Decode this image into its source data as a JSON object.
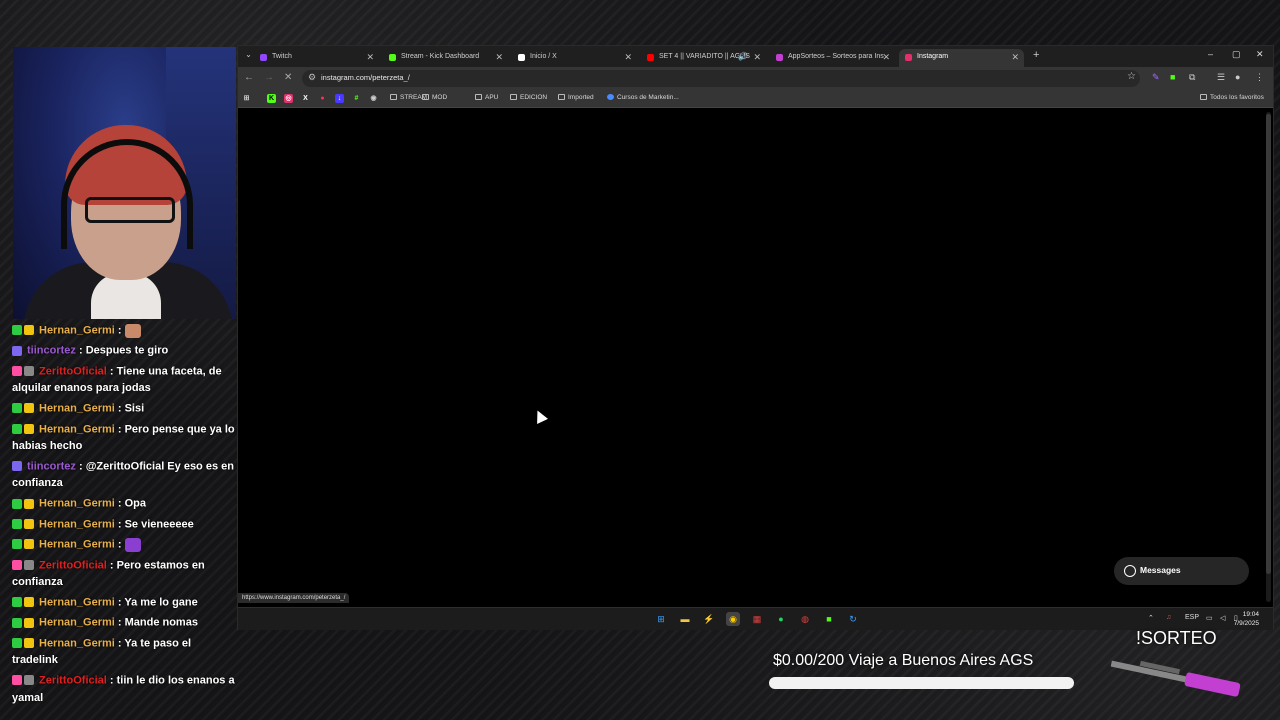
{
  "browser": {
    "tabs": [
      {
        "label": "Twitch",
        "favicon_color": "#9146ff"
      },
      {
        "label": "Stream - Kick Dashboard",
        "favicon_color": "#53fc18"
      },
      {
        "label": "Inicio / X",
        "favicon_color": "#ffffff"
      },
      {
        "label": "SET 4 || VARIADITO || AGUS",
        "favicon_color": "#ff0000"
      },
      {
        "label": "AppSorteos – Sorteos para Ins",
        "favicon_color": "#c23fd1"
      },
      {
        "label": "Instagram",
        "favicon_color": "#e1306c",
        "active": true
      }
    ],
    "address": "instagram.com/peterzeta_/",
    "bookmarks": [
      "STREAM",
      "MOD",
      "APU",
      "EDICION",
      "Imported",
      "Cursos de Marketin..."
    ],
    "all_bookmarks": "Todos los favoritos",
    "status_url": "https://www.instagram.com/peterzeta_/",
    "messages_button": "Messages"
  },
  "taskbar": {
    "language": "ESP",
    "time": "19:04",
    "date": "7/9/2025"
  },
  "chat": [
    {
      "user": "Hernan_Germi",
      "color": "#e8b04a",
      "badges": [
        "#2ecc40",
        "#f1c40f"
      ],
      "text": "",
      "emote": "#c98a6a"
    },
    {
      "user": "tiincortez",
      "color": "#9b59d0",
      "badges": [
        "#7b68ee"
      ],
      "text": "Despues te giro"
    },
    {
      "user": "ZerittoOficial",
      "color": "#e02020",
      "badges": [
        "#ff4fa3",
        "#888888"
      ],
      "text": "Tiene una faceta, de alquilar enanos para jodas"
    },
    {
      "user": "Hernan_Germi",
      "color": "#e8b04a",
      "badges": [
        "#2ecc40",
        "#f1c40f"
      ],
      "text": "Sisi"
    },
    {
      "user": "Hernan_Germi",
      "color": "#e8b04a",
      "badges": [
        "#2ecc40",
        "#f1c40f"
      ],
      "text": "Pero pense que ya lo habias hecho"
    },
    {
      "user": "tiincortez",
      "color": "#9b59d0",
      "badges": [
        "#7b68ee"
      ],
      "text": "@ZerittoOficial Ey eso es en confianza"
    },
    {
      "user": "Hernan_Germi",
      "color": "#e8b04a",
      "badges": [
        "#2ecc40",
        "#f1c40f"
      ],
      "text": "Opa"
    },
    {
      "user": "Hernan_Germi",
      "color": "#e8b04a",
      "badges": [
        "#2ecc40",
        "#f1c40f"
      ],
      "text": "Se vieneeeee"
    },
    {
      "user": "Hernan_Germi",
      "color": "#e8b04a",
      "badges": [
        "#2ecc40",
        "#f1c40f"
      ],
      "text": "",
      "emote": "#8a3fd1"
    },
    {
      "user": "ZerittoOficial",
      "color": "#e02020",
      "badges": [
        "#ff4fa3",
        "#888888"
      ],
      "text": "Pero estamos en confianza"
    },
    {
      "user": "Hernan_Germi",
      "color": "#e8b04a",
      "badges": [
        "#2ecc40",
        "#f1c40f"
      ],
      "text": "Ya me lo gane"
    },
    {
      "user": "Hernan_Germi",
      "color": "#e8b04a",
      "badges": [
        "#2ecc40",
        "#f1c40f"
      ],
      "text": "Mande nomas"
    },
    {
      "user": "Hernan_Germi",
      "color": "#e8b04a",
      "badges": [
        "#2ecc40",
        "#f1c40f"
      ],
      "text": "Ya te paso el tradelink"
    },
    {
      "user": "ZerittoOficial",
      "color": "#e02020",
      "badges": [
        "#ff4fa3",
        "#888888"
      ],
      "text": "tiin le dio los enanos a yamal"
    }
  ],
  "overlay": {
    "sorteo": "!SORTEO",
    "goal_text": "$0.00/200 Viaje a Buenos Aires AGS",
    "goal_progress": 0.0
  }
}
